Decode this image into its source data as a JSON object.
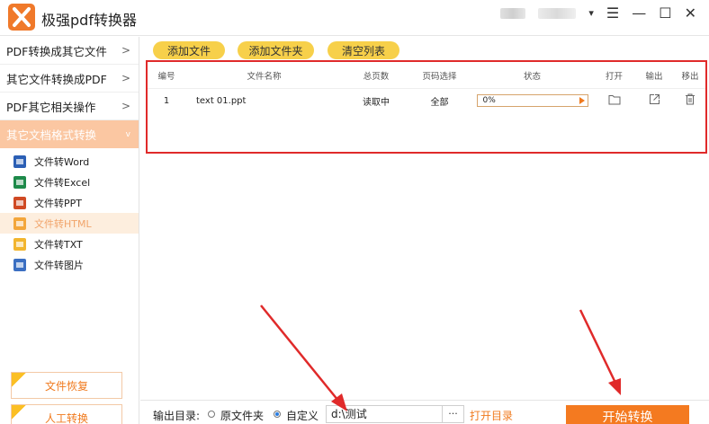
{
  "app": {
    "title": "极强pdf转换器"
  },
  "window_controls": {
    "dropdown": "▾",
    "menu": "☰",
    "minimize": "—",
    "maximize": "☐",
    "close": "✕"
  },
  "sidebar": {
    "menus": [
      {
        "label": "PDF转换成其它文件",
        "chevron": ">"
      },
      {
        "label": "其它文件转换成PDF",
        "chevron": ">"
      },
      {
        "label": "PDF其它相关操作",
        "chevron": ">"
      },
      {
        "label": "其它文档格式转换",
        "chevron": "v",
        "active": true
      }
    ],
    "sub_items": [
      {
        "label": "文件转Word",
        "icon": "word-file-icon",
        "color": "#2b5fb5"
      },
      {
        "label": "文件转Excel",
        "icon": "excel-file-icon",
        "color": "#1e8a4a"
      },
      {
        "label": "文件转PPT",
        "icon": "ppt-file-icon",
        "color": "#d04a24"
      },
      {
        "label": "文件转HTML",
        "icon": "html-file-icon",
        "color": "#f3a63b",
        "active": true
      },
      {
        "label": "文件转TXT",
        "icon": "txt-file-icon",
        "color": "#f2b52e"
      },
      {
        "label": "文件转图片",
        "icon": "image-file-icon",
        "color": "#3b6fc2"
      }
    ],
    "bottom": {
      "recover": "文件恢复",
      "manual": "人工转换"
    }
  },
  "toolbar": {
    "add_file": "添加文件",
    "add_folder": "添加文件夹",
    "clear_list": "清空列表"
  },
  "table": {
    "headers": [
      "编号",
      "文件名称",
      "总页数",
      "页码选择",
      "状态",
      "打开",
      "输出",
      "移出"
    ],
    "rows": [
      {
        "index": "1",
        "name": "text 01.ppt",
        "pages": "读取中",
        "page_select": "全部",
        "progress": "0%",
        "progress_value": 0
      }
    ]
  },
  "output": {
    "label": "输出目录:",
    "option_original": "原文件夹",
    "option_custom": "自定义",
    "selected": "custom",
    "path": "d:\\测试",
    "browse": "···",
    "open_dir": "打开目录",
    "start": "开始转换"
  },
  "colors": {
    "accent": "#f47a20",
    "pill": "#f7d04a",
    "highlight_border": "#e02a2a",
    "annotation_arrow": "#e02a2a"
  }
}
